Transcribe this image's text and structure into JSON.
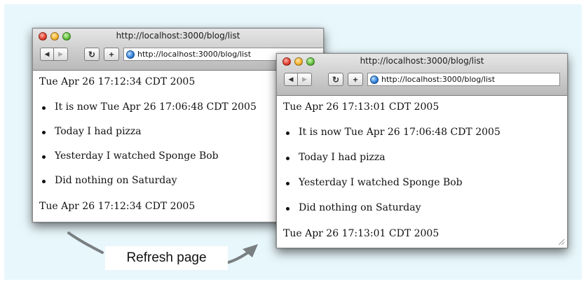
{
  "caption": "Refresh page",
  "window_before": {
    "title": "http://localhost:3000/blog/list",
    "url": "http://localhost:3000/blog/list",
    "reload_icon": "reload-icon",
    "add_icon": "plus-icon",
    "timestamp_top": "Tue Apr 26 17:12:34 CDT 2005",
    "items": [
      "It is now Tue Apr 26 17:06:48 CDT 2005",
      "Today I had pizza",
      "Yesterday I watched Sponge Bob",
      "Did nothing on Saturday"
    ],
    "timestamp_bottom": "Tue Apr 26 17:12:34 CDT 2005"
  },
  "window_after": {
    "title": "http://localhost:3000/blog/list",
    "url": "http://localhost:3000/blog/list",
    "reload_icon": "reload-icon",
    "add_icon": "plus-icon",
    "timestamp_top": "Tue Apr 26 17:13:01 CDT 2005",
    "items": [
      "It is now Tue Apr 26 17:06:48 CDT 2005",
      "Today I had pizza",
      "Yesterday I watched Sponge Bob",
      "Did nothing on Saturday"
    ],
    "timestamp_bottom": "Tue Apr 26 17:13:01 CDT 2005"
  },
  "colors": {
    "background": "#e8f7fc",
    "arrow": "#7a7f82"
  }
}
